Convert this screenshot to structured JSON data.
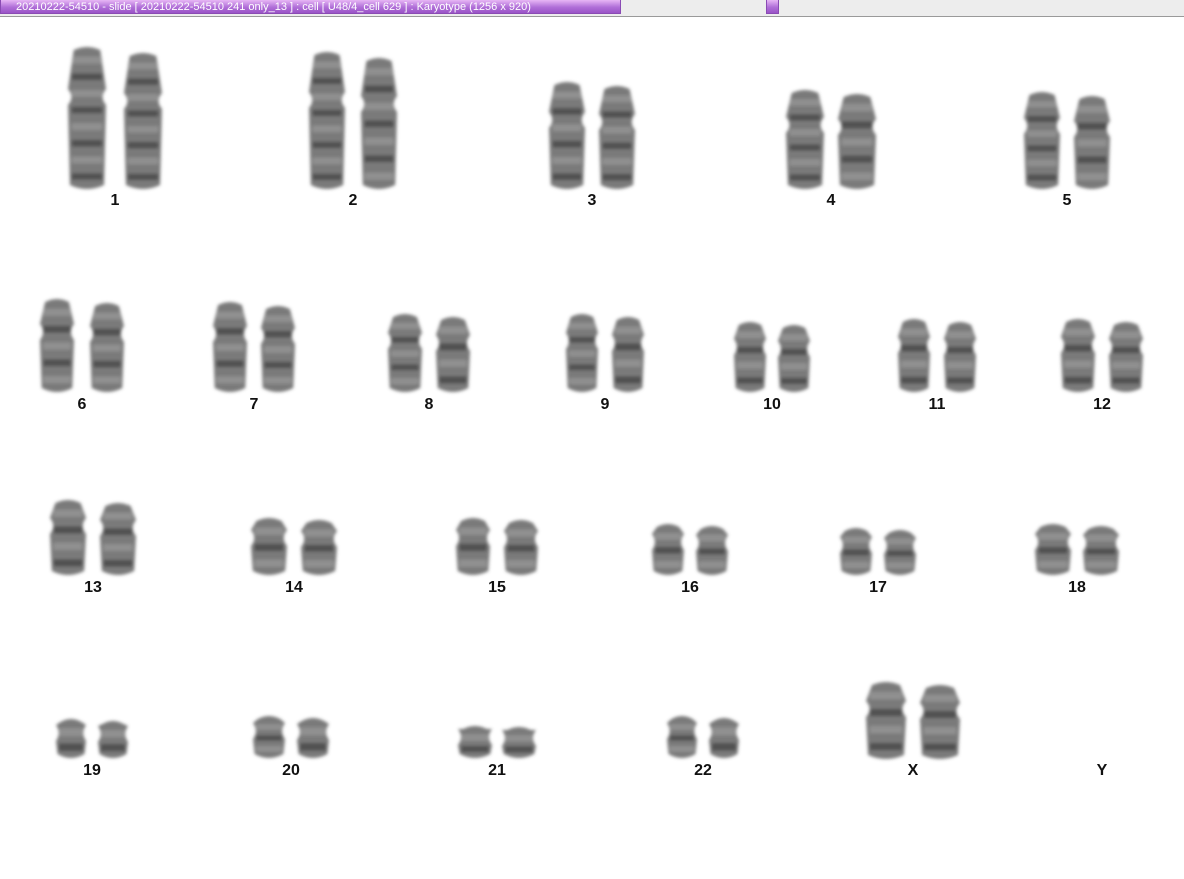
{
  "window": {
    "title": "20210222-54510 - slide [ 20210222-54510 241 only_13 ] : cell [ U48/4_cell 629 ] : Karyotype  (1256 x 920)"
  },
  "karyotype": {
    "pairs": [
      {
        "label": "1",
        "count": 2
      },
      {
        "label": "2",
        "count": 2
      },
      {
        "label": "3",
        "count": 2
      },
      {
        "label": "4",
        "count": 2
      },
      {
        "label": "5",
        "count": 2
      },
      {
        "label": "6",
        "count": 2
      },
      {
        "label": "7",
        "count": 2
      },
      {
        "label": "8",
        "count": 2
      },
      {
        "label": "9",
        "count": 2
      },
      {
        "label": "10",
        "count": 2
      },
      {
        "label": "11",
        "count": 2
      },
      {
        "label": "12",
        "count": 2
      },
      {
        "label": "13",
        "count": 2
      },
      {
        "label": "14",
        "count": 2
      },
      {
        "label": "15",
        "count": 2
      },
      {
        "label": "16",
        "count": 2
      },
      {
        "label": "17",
        "count": 2
      },
      {
        "label": "18",
        "count": 2
      },
      {
        "label": "19",
        "count": 2
      },
      {
        "label": "20",
        "count": 2
      },
      {
        "label": "21",
        "count": 2
      },
      {
        "label": "22",
        "count": 2
      },
      {
        "label": "X",
        "count": 2
      },
      {
        "label": "Y",
        "count": 0
      }
    ],
    "colors": {
      "chromatin": "#555555",
      "label": "#111111"
    }
  }
}
